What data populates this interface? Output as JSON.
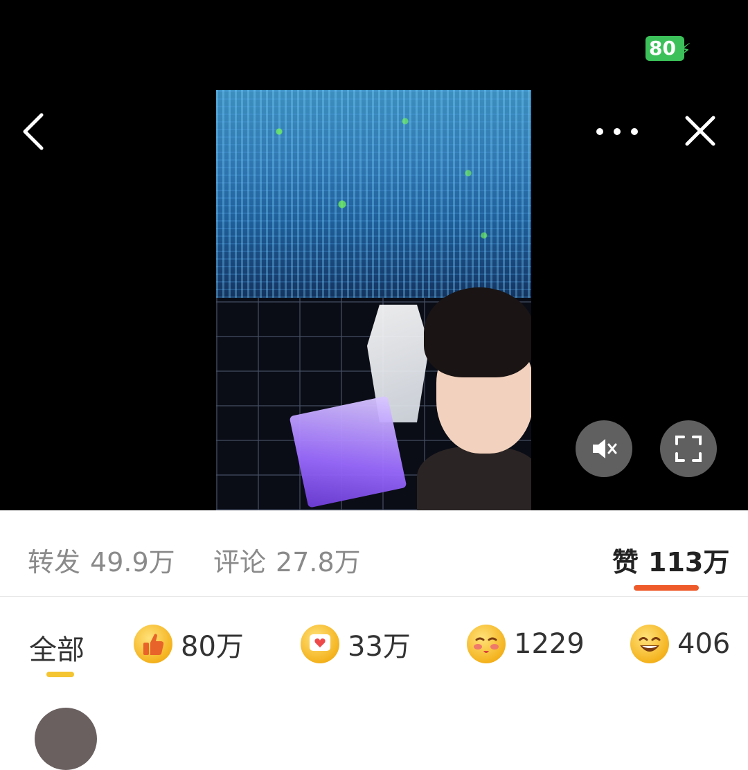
{
  "status_bar": {
    "battery": "80"
  },
  "video": {
    "back_icon": "chevron-left-icon",
    "more_icon": "more-dots-icon",
    "close_icon": "close-icon",
    "mute_icon": "speaker-muted-icon",
    "fullscreen_icon": "fullscreen-icon"
  },
  "stats": {
    "repost_label": "转发",
    "repost_count": "49.9万",
    "comment_label": "评论",
    "comment_count": "27.8万",
    "like_label": "赞",
    "like_count": "113万",
    "accent_color": "#ee5a2a"
  },
  "reactions": {
    "all_label": "全部",
    "items": [
      {
        "icon": "thumbs-up-icon",
        "count": "80万"
      },
      {
        "icon": "heart-bubble-icon",
        "count": "33万"
      },
      {
        "icon": "blush-kiss-icon",
        "count": "1229"
      },
      {
        "icon": "laughing-face-icon",
        "count": "406"
      }
    ],
    "tab_indicator_color": "#f4c431"
  }
}
